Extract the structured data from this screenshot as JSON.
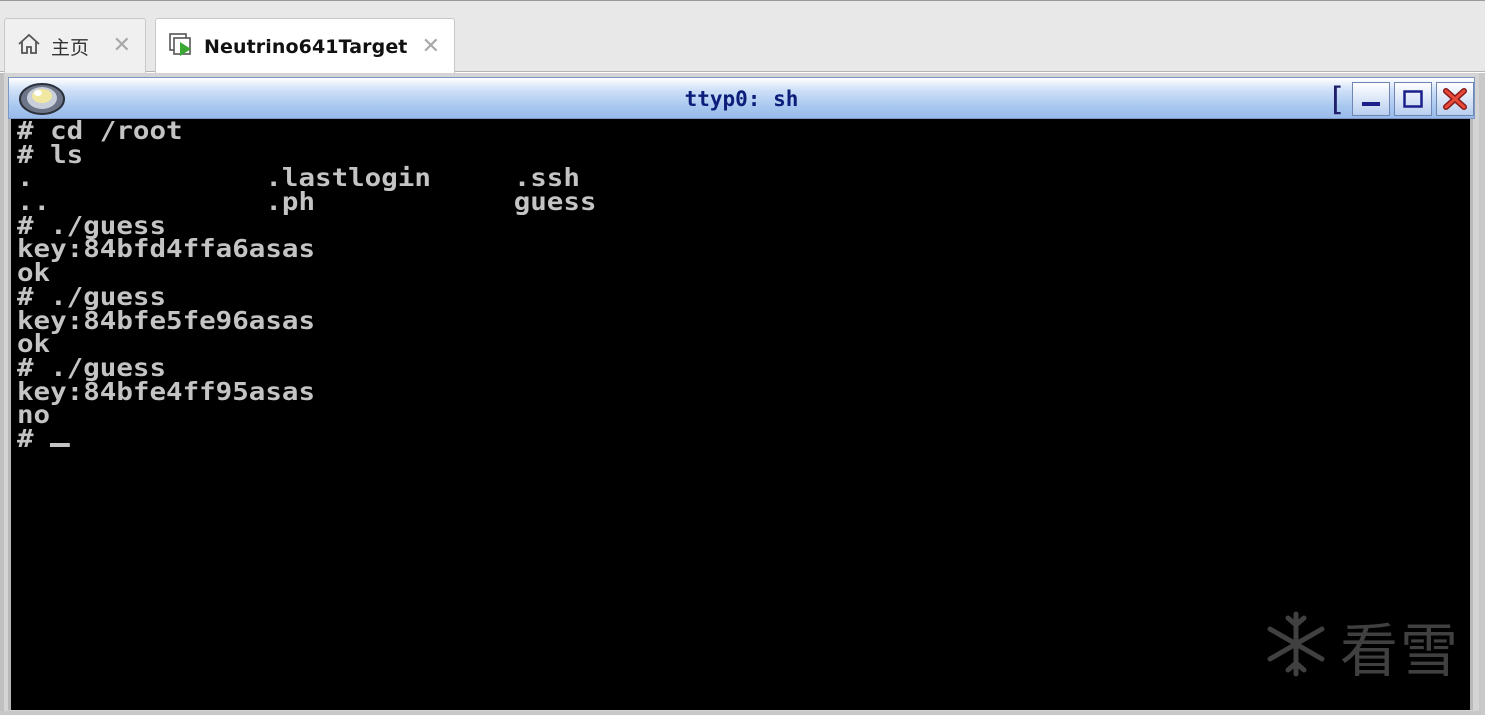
{
  "tabs": [
    {
      "label": "主页",
      "icon": "home-icon"
    },
    {
      "label": "Neutrino641Target",
      "icon": "vm-play-icon"
    }
  ],
  "window": {
    "title": "ttyp0: sh"
  },
  "terminal": {
    "lines": [
      "# cd /root",
      "# ls",
      ".              .lastlogin     .ssh",
      "..             .ph            guess",
      "# ./guess",
      "key:84bfd4ffa6asas",
      "ok",
      "# ./guess",
      "key:84bfe5fe96asas",
      "ok",
      "# ./guess",
      "key:84bfe4ff95asas",
      "no"
    ],
    "prompt": "# "
  },
  "watermark": {
    "text": "看雪"
  },
  "colors": {
    "terminal_bg": "#000000",
    "terminal_fg": "#c4c4c4",
    "title_text": "#0d1e7a",
    "vm_play_green": "#3aa832"
  }
}
